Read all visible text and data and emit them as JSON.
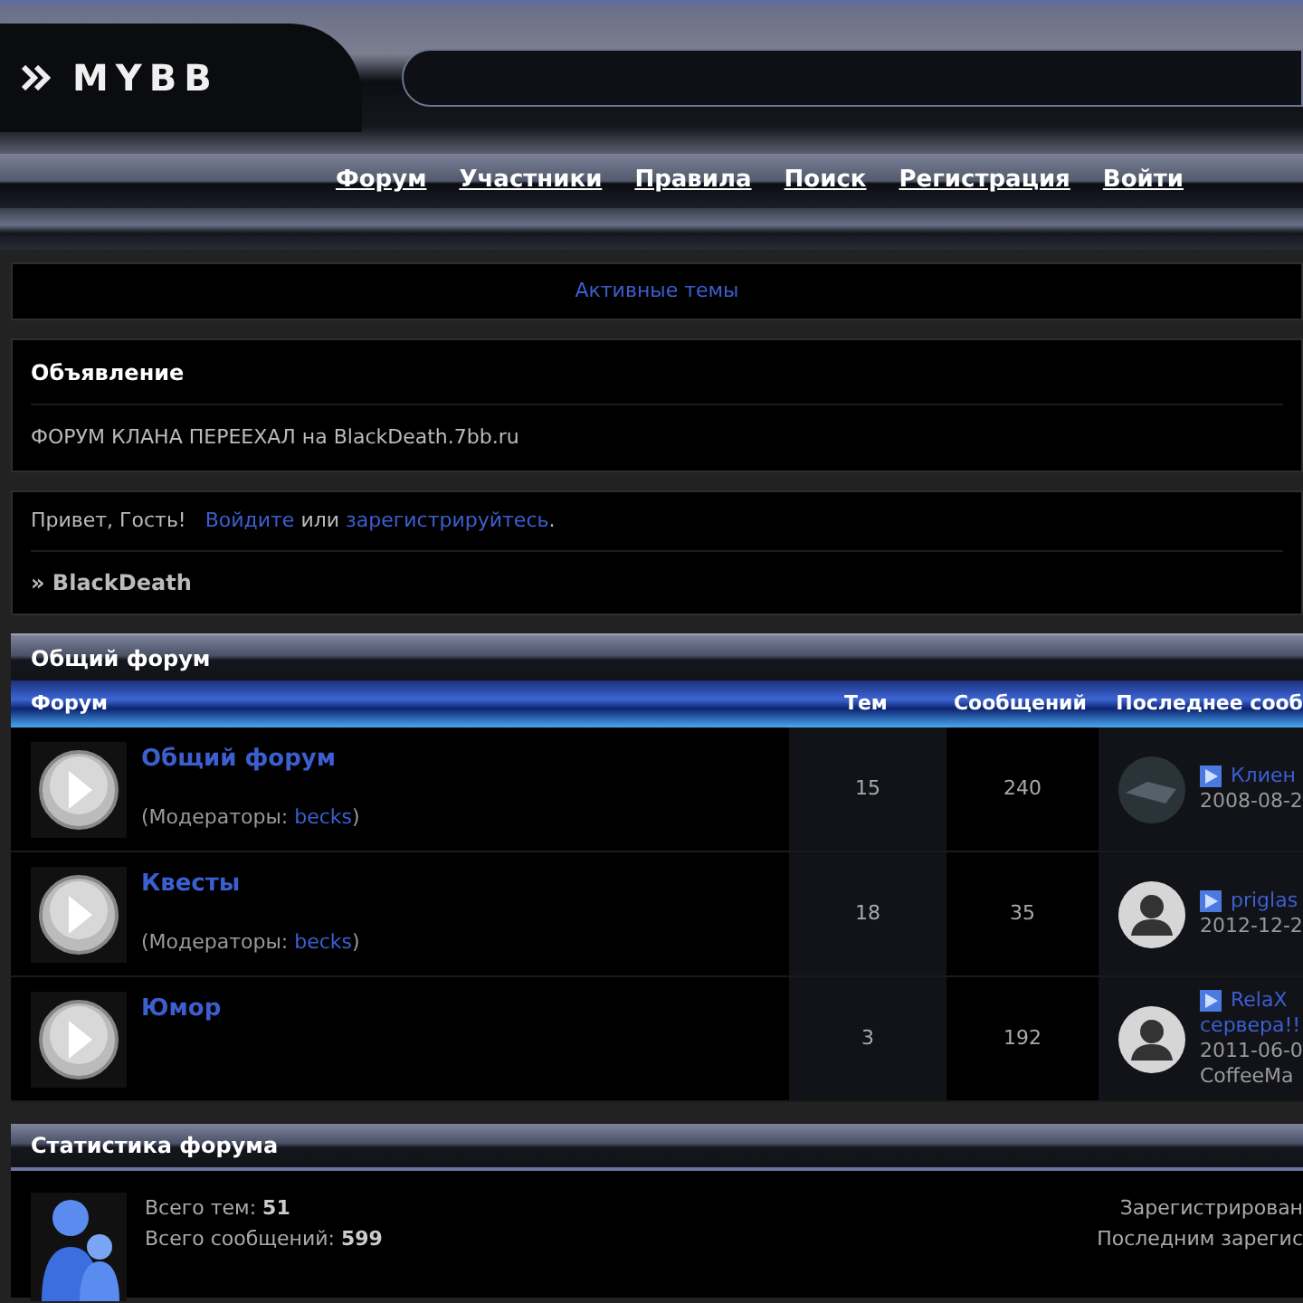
{
  "header": {
    "logo": "MYBB"
  },
  "nav": [
    "Форум",
    "Участники",
    "Правила",
    "Поиск",
    "Регистрация",
    "Войти"
  ],
  "active_topics_link": "Активные темы",
  "announcement": {
    "title": "Объявление",
    "text": "ФОРУМ КЛАНА ПЕРЕЕХАЛ на BlackDeath.7bb.ru"
  },
  "welcome": {
    "greeting": "Привет, Гость!",
    "login_link": "Войдите",
    "joiner": "или",
    "register_link": "зарегистрируйтесь",
    "end": "."
  },
  "breadcrumb": {
    "separator": "»",
    "current": "BlackDeath"
  },
  "category": {
    "title": "Общий форум",
    "columns": [
      "Форум",
      "Тем",
      "Сообщений",
      "Последнее сооб"
    ],
    "rows": [
      {
        "name": "Общий форум",
        "moderators": {
          "prefix": "(Модераторы: ",
          "name": "becks",
          "suffix": ")"
        },
        "topics": "15",
        "posts": "240",
        "last_post": {
          "kind": "photo",
          "title": [
            "Клиен"
          ],
          "lines": [
            "2008-08-2"
          ]
        }
      },
      {
        "name": "Квесты",
        "moderators": {
          "prefix": "(Модераторы: ",
          "name": "becks",
          "suffix": ")"
        },
        "topics": "18",
        "posts": "35",
        "last_post": {
          "kind": "silhouette",
          "title": [
            "priglas"
          ],
          "lines": [
            "2012-12-2"
          ]
        }
      },
      {
        "name": "Юмор",
        "topics": "3",
        "posts": "192",
        "last_post": {
          "kind": "silhouette",
          "title": [
            "RelaX",
            "сервера!!"
          ],
          "lines": [
            "2011-06-0",
            "CoffeeMa"
          ]
        }
      }
    ]
  },
  "stats": {
    "title": "Статистика форума",
    "left": [
      {
        "label": "Всего тем:",
        "value": "51"
      },
      {
        "label": "Всего сообщений:",
        "value": "599"
      }
    ],
    "right": [
      "Зарегистрирован",
      "Последним зарегис"
    ]
  }
}
